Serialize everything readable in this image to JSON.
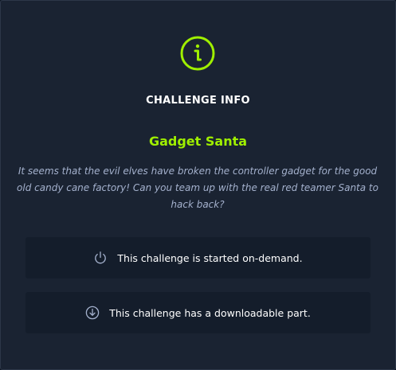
{
  "modal": {
    "heading": "CHALLENGE INFO",
    "title": "Gadget Santa",
    "description": "It seems that the evil elves have broken the controller gadget for the good old candy cane factory! Can you team up with the real red teamer Santa to hack back?",
    "info_icon": "info-circle-icon",
    "accent_color": "#9fef00"
  },
  "features": [
    {
      "icon": "power-icon",
      "text": "This challenge is started on-demand."
    },
    {
      "icon": "download-circle-icon",
      "text": "This challenge has a downloadable part."
    }
  ]
}
